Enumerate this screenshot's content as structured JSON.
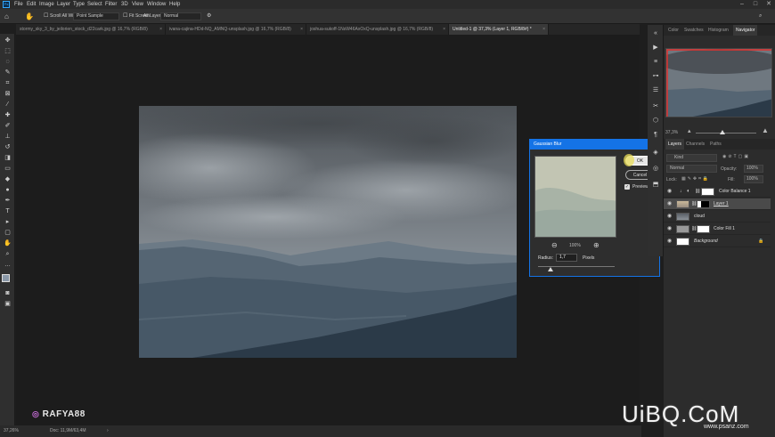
{
  "menu": {
    "app_icon": "Ps",
    "items": [
      "File",
      "Edit",
      "Image",
      "Layer",
      "Type",
      "Select",
      "Filter",
      "3D",
      "View",
      "Window",
      "Help"
    ]
  },
  "options": {
    "scroll_all": "Scroll All Windows",
    "sample_value": "Point Sample",
    "fit_screen": "Fit Screen",
    "all_layers": "All Layers",
    "mode_value": "Normal"
  },
  "tabs": [
    {
      "label": "stormy_sky_3_by_jeilorien_stock_d22cark.jpg @ 16,7% (RGB/8)"
    },
    {
      "label": "ivana-cajina-HDd-NQ_AMNQ-unsplash.jpg @ 16,7% (RGB/8)"
    },
    {
      "label": "joshua-sukoff-1NsW46AxOxQ-unsplash.jpg @ 16,7% (RGB/8)"
    },
    {
      "label": "Untitled-1 @ 37,3% (Layer 1, RGB/8#) *"
    }
  ],
  "status": {
    "zoom": "37,26%",
    "doc": "Doc: 11,9M/63,4M"
  },
  "dialog": {
    "title": "Gaussian Blur",
    "ok": "OK",
    "cancel": "Cancel",
    "preview": "Preview",
    "preview_checked": true,
    "zoom": "100%",
    "radius_label": "Radius:",
    "radius_value": "1,7",
    "radius_unit": "Pixels",
    "radius_slider_fraction": 0.16
  },
  "panel_tabs_top": [
    "Color",
    "Swatches",
    "Histogram",
    "Navigator"
  ],
  "navigator": {
    "zoom": "37,3%"
  },
  "panel_tabs_layers": [
    "Layers",
    "Channels",
    "Paths"
  ],
  "layers_panel": {
    "kind": "Kind",
    "blend": "Normal",
    "opacity_label": "Opacity:",
    "opacity": "100%",
    "lock_label": "Lock:",
    "fill_label": "Fill:",
    "fill": "100%"
  },
  "layers": [
    {
      "name": "Color Balance 1"
    },
    {
      "name": "Layer 1"
    },
    {
      "name": "cloud"
    },
    {
      "name": "Color Fill 1"
    },
    {
      "name": "Background"
    }
  ],
  "watermarks": {
    "author": "RAFYA88",
    "site": "UiBQ.CoM",
    "site_url": "www.psanz.com"
  },
  "colors": {
    "accent": "#1473e6",
    "highlight": "#e8dc5a"
  }
}
